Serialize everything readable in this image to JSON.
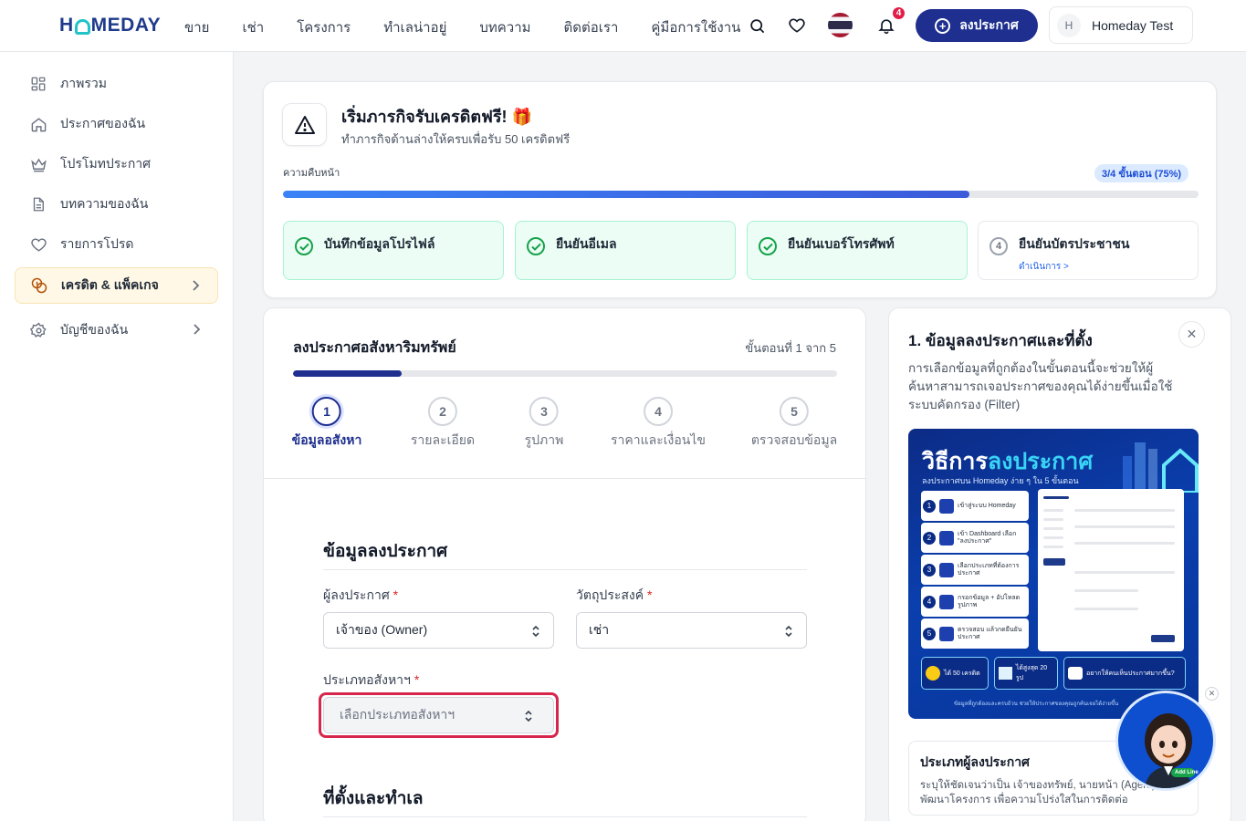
{
  "brand": {
    "logo_pre": "H",
    "logo_post": "MEDAY",
    "accent": "#1e2f8f",
    "teal": "#22c3c9"
  },
  "nav": [
    "ขาย",
    "เช่า",
    "โครงการ",
    "ทำเลน่าอยู่",
    "บทความ",
    "ติดต่อเรา",
    "คู่มือการใช้งาน"
  ],
  "header": {
    "notification_count": "4",
    "post_button": "ลงประกาศ",
    "user_initial": "H",
    "user_name": "Homeday Test"
  },
  "sidebar": {
    "items": [
      {
        "label": "ภาพรวม",
        "icon": "grid-icon"
      },
      {
        "label": "ประกาศของฉัน",
        "icon": "home-icon"
      },
      {
        "label": "โปรโมทประกาศ",
        "icon": "crown-icon"
      },
      {
        "label": "บทความของฉัน",
        "icon": "document-icon"
      },
      {
        "label": "รายการโปรด",
        "icon": "heart-icon"
      },
      {
        "label": "เครดิต & แพ็คเกจ",
        "icon": "coins-icon",
        "active": true
      },
      {
        "label": "บัญชีของฉัน",
        "icon": "gear-icon"
      }
    ]
  },
  "mission": {
    "title": "เริ่มภารกิจรับเครดิตฟรี! 🎁",
    "subtitle": "ทำภารกิจด้านล่างให้ครบเพื่อรับ 50 เครดิตฟรี",
    "progress_label": "ความคืบหน้า",
    "progress_badge": "3/4 ขั้นตอน (75%)",
    "progress_fraction": 0.75,
    "tasks": [
      {
        "label": "บันทึกข้อมูลโปรไฟล์",
        "done": true
      },
      {
        "label": "ยืนยันอีเมล",
        "done": true
      },
      {
        "label": "ยืนยันเบอร์โทรศัพท์",
        "done": true
      },
      {
        "label": "ยืนยันบัตรประชาชน",
        "done": false,
        "number": "4",
        "action": "ดำเนินการ >"
      }
    ]
  },
  "form": {
    "title": "ลงประกาศอสังหาริมทรัพย์",
    "step_text": "ขั้นตอนที่ 1 จาก 5",
    "progress_fraction": 0.2,
    "steps": [
      {
        "num": "1",
        "label": "ข้อมูลอสังหา",
        "active": true
      },
      {
        "num": "2",
        "label": "รายละเอียด"
      },
      {
        "num": "3",
        "label": "รูปภาพ"
      },
      {
        "num": "4",
        "label": "ราคาและเงื่อนไข"
      },
      {
        "num": "5",
        "label": "ตรวจสอบข้อมูล"
      }
    ],
    "section1_title": "ข้อมูลลงประกาศ",
    "poster_label": "ผู้ลงประกาศ",
    "poster_value": "เจ้าของ (Owner)",
    "purpose_label": "วัตถุประสงค์",
    "purpose_value": "เช่า",
    "type_label": "ประเภทอสังหาฯ",
    "type_placeholder": "เลือกประเภทอสังหาฯ",
    "required_mark": "*",
    "section2_title": "ที่ตั้งและทำเล"
  },
  "help": {
    "title": "1. ข้อมูลลงประกาศและที่ตั้ง",
    "description": "การเลือกข้อมูลที่ถูกต้องในขั้นตอนนี้จะช่วยให้ผู้ค้นหาสามารถเจอประกาศของคุณได้ง่ายขึ้นเมื่อใช้ระบบคัดกรอง (Filter)",
    "poster": {
      "title_a": "วิธีการ",
      "title_b": "ลงประกาศ",
      "subtitle": "ลงประกาศบน Homeday ง่าย ๆ ใน 5 ขั้นตอน",
      "steps": [
        {
          "n": "1",
          "t": "เข้าสู่ระบบ Homeday"
        },
        {
          "n": "2",
          "t": "เข้า Dashboard เลือก \"ลงประกาศ\""
        },
        {
          "n": "3",
          "t": "เลือกประเภทที่ต้องการประกาศ"
        },
        {
          "n": "4",
          "t": "กรอกข้อมูล + อัปโหลดรูปภาพ"
        },
        {
          "n": "5",
          "t": "ตรวจสอบ แล้วกดยืนยันประกาศ"
        }
      ],
      "perk1": "ได้ 50 เครดิต",
      "perk2": "ได้สูงสุด 20 รูป",
      "perk3": "อยากให้คนเห็นประกาศมากขึ้น?",
      "footer": "ข้อมูลที่ถูกต้องและครบถ้วน ช่วยให้ประกาศของคุณถูกค้นเจอได้ง่ายขึ้น"
    },
    "card_title": "ประเภทผู้ลงประกาศ",
    "card_text1": "ระบุให้ชัดเจนว่าเป็น เจ้าของทรัพย์, นายหน้า (Agent)",
    "card_text2": "พัฒนาโครงการ เพื่อความโปร่งใสในการติดต่อ"
  },
  "mascot": {
    "line_label": "Add Line"
  }
}
